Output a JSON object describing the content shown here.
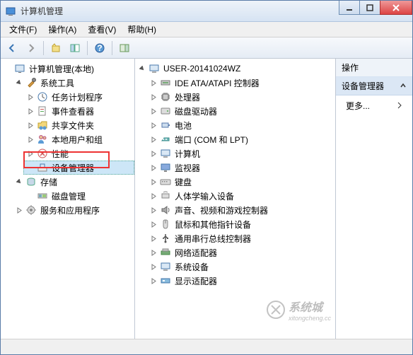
{
  "window": {
    "title": "计算机管理"
  },
  "menubar": {
    "file": "文件(F)",
    "action": "操作(A)",
    "view": "查看(V)",
    "help": "帮助(H)"
  },
  "left_tree": {
    "root": "计算机管理(本地)",
    "system_tools": "系统工具",
    "task_scheduler": "任务计划程序",
    "event_viewer": "事件查看器",
    "shared_folders": "共享文件夹",
    "local_users": "本地用户和组",
    "performance": "性能",
    "device_manager": "设备管理器",
    "storage": "存储",
    "disk_management": "磁盘管理",
    "services_apps": "服务和应用程序"
  },
  "center_tree": {
    "root": "USER-20141024WZ",
    "ide": "IDE ATA/ATAPI 控制器",
    "cpu": "处理器",
    "disk_drives": "磁盘驱动器",
    "battery": "电池",
    "ports": "端口 (COM 和 LPT)",
    "computer": "计算机",
    "monitors": "监视器",
    "keyboards": "键盘",
    "hid": "人体学输入设备",
    "sound": "声音、视频和游戏控制器",
    "mouse": "鼠标和其他指针设备",
    "usb": "通用串行总线控制器",
    "network": "网络适配器",
    "system_devices": "系统设备",
    "display": "显示适配器"
  },
  "right_pane": {
    "header": "操作",
    "subheader": "设备管理器",
    "more": "更多..."
  },
  "watermark": {
    "text": "系统城",
    "sub": "xitongcheng.cc"
  }
}
